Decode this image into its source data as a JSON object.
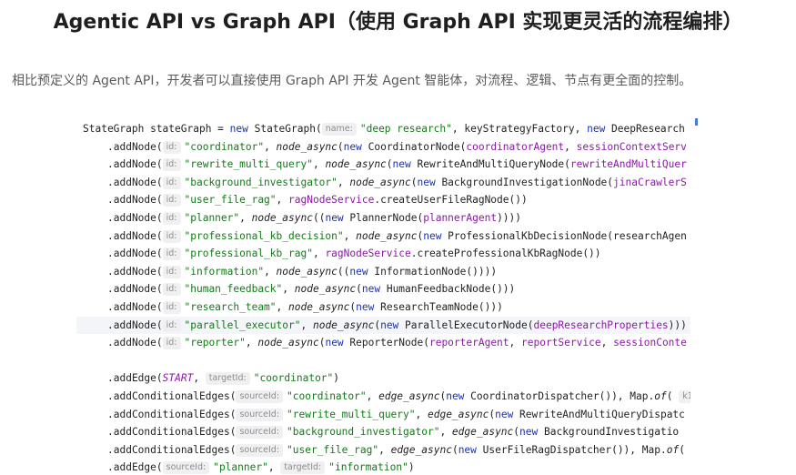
{
  "header": {
    "title": "Agentic API vs Graph API（使用 Graph API 实现更灵活的流程编排）",
    "subtitle": "相比预定义的 Agent API，开发者可以直接使用 Graph API 开发 Agent 智能体，对流程、逻辑、节点有更全面的控制。"
  },
  "code": {
    "lines": [
      {
        "indent": 0,
        "highlight": false,
        "tokens": [
          {
            "t": "StateGraph stateGraph = ",
            "c": "plain"
          },
          {
            "t": "new",
            "c": "kw"
          },
          {
            "t": " StateGraph(",
            "c": "plain"
          },
          {
            "t": "name:",
            "c": "hint"
          },
          {
            "t": "\"deep research\"",
            "c": "str"
          },
          {
            "t": ", keyStrategyFactory, ",
            "c": "plain"
          },
          {
            "t": "new",
            "c": "kw"
          },
          {
            "t": " DeepResearch",
            "c": "plain"
          }
        ]
      },
      {
        "indent": 4,
        "highlight": false,
        "tokens": [
          {
            "t": ".addNode(",
            "c": "plain"
          },
          {
            "t": "id:",
            "c": "hint"
          },
          {
            "t": "\"coordinator\"",
            "c": "str"
          },
          {
            "t": ", ",
            "c": "plain"
          },
          {
            "t": "node_async",
            "c": "fn"
          },
          {
            "t": "(",
            "c": "plain"
          },
          {
            "t": "new",
            "c": "kw"
          },
          {
            "t": " CoordinatorNode(",
            "c": "plain"
          },
          {
            "t": "coordinatorAgent",
            "c": "field"
          },
          {
            "t": ", ",
            "c": "plain"
          },
          {
            "t": "sessionContextServ",
            "c": "field"
          }
        ]
      },
      {
        "indent": 4,
        "highlight": false,
        "tokens": [
          {
            "t": ".addNode(",
            "c": "plain"
          },
          {
            "t": "id:",
            "c": "hint"
          },
          {
            "t": "\"rewrite_multi_query\"",
            "c": "str"
          },
          {
            "t": ", ",
            "c": "plain"
          },
          {
            "t": "node_async",
            "c": "fn"
          },
          {
            "t": "(",
            "c": "plain"
          },
          {
            "t": "new",
            "c": "kw"
          },
          {
            "t": " RewriteAndMultiQueryNode(",
            "c": "plain"
          },
          {
            "t": "rewriteAndMultiQuer",
            "c": "field"
          }
        ]
      },
      {
        "indent": 4,
        "highlight": false,
        "tokens": [
          {
            "t": ".addNode(",
            "c": "plain"
          },
          {
            "t": "id:",
            "c": "hint"
          },
          {
            "t": "\"background_investigator\"",
            "c": "str"
          },
          {
            "t": ", ",
            "c": "plain"
          },
          {
            "t": "node_async",
            "c": "fn"
          },
          {
            "t": "(",
            "c": "plain"
          },
          {
            "t": "new",
            "c": "kw"
          },
          {
            "t": " BackgroundInvestigationNode(",
            "c": "plain"
          },
          {
            "t": "jinaCrawlerS",
            "c": "field"
          }
        ]
      },
      {
        "indent": 4,
        "highlight": false,
        "tokens": [
          {
            "t": ".addNode(",
            "c": "plain"
          },
          {
            "t": "id:",
            "c": "hint"
          },
          {
            "t": "\"user_file_rag\"",
            "c": "str"
          },
          {
            "t": ", ",
            "c": "plain"
          },
          {
            "t": "ragNodeService",
            "c": "field"
          },
          {
            "t": ".createUserFileRagNode())",
            "c": "plain"
          }
        ]
      },
      {
        "indent": 4,
        "highlight": false,
        "tokens": [
          {
            "t": ".addNode(",
            "c": "plain"
          },
          {
            "t": "id:",
            "c": "hint"
          },
          {
            "t": "\"planner\"",
            "c": "str"
          },
          {
            "t": ", ",
            "c": "plain"
          },
          {
            "t": "node_async",
            "c": "fn"
          },
          {
            "t": "((",
            "c": "plain"
          },
          {
            "t": "new",
            "c": "kw"
          },
          {
            "t": " PlannerNode(",
            "c": "plain"
          },
          {
            "t": "plannerAgent",
            "c": "field"
          },
          {
            "t": "))))",
            "c": "plain"
          }
        ]
      },
      {
        "indent": 4,
        "highlight": false,
        "tokens": [
          {
            "t": ".addNode(",
            "c": "plain"
          },
          {
            "t": "id:",
            "c": "hint"
          },
          {
            "t": "\"professional_kb_decision\"",
            "c": "str"
          },
          {
            "t": ", ",
            "c": "plain"
          },
          {
            "t": "node_async",
            "c": "fn"
          },
          {
            "t": "(",
            "c": "plain"
          },
          {
            "t": "new",
            "c": "kw"
          },
          {
            "t": " ProfessionalKbDecisionNode(researchAgen",
            "c": "plain"
          }
        ]
      },
      {
        "indent": 4,
        "highlight": false,
        "tokens": [
          {
            "t": ".addNode(",
            "c": "plain"
          },
          {
            "t": "id:",
            "c": "hint"
          },
          {
            "t": "\"professional_kb_rag\"",
            "c": "str"
          },
          {
            "t": ", ",
            "c": "plain"
          },
          {
            "t": "ragNodeService",
            "c": "field"
          },
          {
            "t": ".createProfessionalKbRagNode())",
            "c": "plain"
          }
        ]
      },
      {
        "indent": 4,
        "highlight": false,
        "tokens": [
          {
            "t": ".addNode(",
            "c": "plain"
          },
          {
            "t": "id:",
            "c": "hint"
          },
          {
            "t": "\"information\"",
            "c": "str"
          },
          {
            "t": ", ",
            "c": "plain"
          },
          {
            "t": "node_async",
            "c": "fn"
          },
          {
            "t": "((",
            "c": "plain"
          },
          {
            "t": "new",
            "c": "kw"
          },
          {
            "t": " InformationNode())))",
            "c": "plain"
          }
        ]
      },
      {
        "indent": 4,
        "highlight": false,
        "tokens": [
          {
            "t": ".addNode(",
            "c": "plain"
          },
          {
            "t": "id:",
            "c": "hint"
          },
          {
            "t": "\"human_feedback\"",
            "c": "str"
          },
          {
            "t": ", ",
            "c": "plain"
          },
          {
            "t": "node_async",
            "c": "fn"
          },
          {
            "t": "(",
            "c": "plain"
          },
          {
            "t": "new",
            "c": "kw"
          },
          {
            "t": " HumanFeedbackNode()))",
            "c": "plain"
          }
        ]
      },
      {
        "indent": 4,
        "highlight": false,
        "tokens": [
          {
            "t": ".addNode(",
            "c": "plain"
          },
          {
            "t": "id:",
            "c": "hint"
          },
          {
            "t": "\"research_team\"",
            "c": "str"
          },
          {
            "t": ", ",
            "c": "plain"
          },
          {
            "t": "node_async",
            "c": "fn"
          },
          {
            "t": "(",
            "c": "plain"
          },
          {
            "t": "new",
            "c": "kw"
          },
          {
            "t": " ResearchTeamNode()))",
            "c": "plain"
          }
        ]
      },
      {
        "indent": 4,
        "highlight": true,
        "tokens": [
          {
            "t": ".addNode(",
            "c": "plain"
          },
          {
            "t": "id:",
            "c": "hint"
          },
          {
            "t": "\"parallel_executor\"",
            "c": "str"
          },
          {
            "t": ", ",
            "c": "plain"
          },
          {
            "t": "node_async",
            "c": "fn"
          },
          {
            "t": "(",
            "c": "plain"
          },
          {
            "t": "new",
            "c": "kw"
          },
          {
            "t": " ParallelExecutorNode(",
            "c": "plain"
          },
          {
            "t": "deepResearchProperties",
            "c": "field"
          },
          {
            "t": ")))",
            "c": "plain"
          }
        ]
      },
      {
        "indent": 4,
        "highlight": false,
        "tokens": [
          {
            "t": ".addNode(",
            "c": "plain"
          },
          {
            "t": "id:",
            "c": "hint"
          },
          {
            "t": "\"reporter\"",
            "c": "str"
          },
          {
            "t": ", ",
            "c": "plain"
          },
          {
            "t": "node_async",
            "c": "fn"
          },
          {
            "t": "(",
            "c": "plain"
          },
          {
            "t": "new",
            "c": "kw"
          },
          {
            "t": " ReporterNode(",
            "c": "plain"
          },
          {
            "t": "reporterAgent",
            "c": "field"
          },
          {
            "t": ", ",
            "c": "plain"
          },
          {
            "t": "reportService",
            "c": "field"
          },
          {
            "t": ", ",
            "c": "plain"
          },
          {
            "t": "sessionConte",
            "c": "field"
          }
        ]
      },
      {
        "indent": 0,
        "highlight": false,
        "tokens": []
      },
      {
        "indent": 4,
        "highlight": false,
        "tokens": [
          {
            "t": ".addEdge(",
            "c": "plain"
          },
          {
            "t": "START",
            "c": "const"
          },
          {
            "t": ",  ",
            "c": "plain"
          },
          {
            "t": "targetId:",
            "c": "hint"
          },
          {
            "t": "\"coordinator\"",
            "c": "str"
          },
          {
            "t": ")",
            "c": "plain"
          }
        ]
      },
      {
        "indent": 4,
        "highlight": false,
        "tokens": [
          {
            "t": ".addConditionalEdges(",
            "c": "plain"
          },
          {
            "t": "sourceId:",
            "c": "hint"
          },
          {
            "t": "\"coordinator\"",
            "c": "str"
          },
          {
            "t": ", ",
            "c": "plain"
          },
          {
            "t": "edge_async",
            "c": "fn"
          },
          {
            "t": "(",
            "c": "plain"
          },
          {
            "t": "new",
            "c": "kw"
          },
          {
            "t": " CoordinatorDispatcher()), Map.",
            "c": "plain"
          },
          {
            "t": "of",
            "c": "fn"
          },
          {
            "t": "( ",
            "c": "plain"
          },
          {
            "t": "k1",
            "c": "hint"
          }
        ]
      },
      {
        "indent": 4,
        "highlight": false,
        "tokens": [
          {
            "t": ".addConditionalEdges(",
            "c": "plain"
          },
          {
            "t": "sourceId:",
            "c": "hint"
          },
          {
            "t": "\"rewrite_multi_query\"",
            "c": "str"
          },
          {
            "t": ", ",
            "c": "plain"
          },
          {
            "t": "edge_async",
            "c": "fn"
          },
          {
            "t": "(",
            "c": "plain"
          },
          {
            "t": "new",
            "c": "kw"
          },
          {
            "t": " RewriteAndMultiQueryDispatc",
            "c": "plain"
          }
        ]
      },
      {
        "indent": 4,
        "highlight": false,
        "tokens": [
          {
            "t": ".addConditionalEdges(",
            "c": "plain"
          },
          {
            "t": "sourceId:",
            "c": "hint"
          },
          {
            "t": "\"background_investigator\"",
            "c": "str"
          },
          {
            "t": ", ",
            "c": "plain"
          },
          {
            "t": "edge_async",
            "c": "fn"
          },
          {
            "t": "(",
            "c": "plain"
          },
          {
            "t": "new",
            "c": "kw"
          },
          {
            "t": " BackgroundInvestigatio",
            "c": "plain"
          }
        ]
      },
      {
        "indent": 4,
        "highlight": false,
        "tokens": [
          {
            "t": ".addConditionalEdges(",
            "c": "plain"
          },
          {
            "t": "sourceId:",
            "c": "hint"
          },
          {
            "t": "\"user_file_rag\"",
            "c": "str"
          },
          {
            "t": ", ",
            "c": "plain"
          },
          {
            "t": "edge_async",
            "c": "fn"
          },
          {
            "t": "(",
            "c": "plain"
          },
          {
            "t": "new",
            "c": "kw"
          },
          {
            "t": " UserFileRagDispatcher()), Map.",
            "c": "plain"
          },
          {
            "t": "of",
            "c": "fn"
          },
          {
            "t": "(",
            "c": "plain"
          }
        ]
      },
      {
        "indent": 4,
        "highlight": false,
        "tokens": [
          {
            "t": ".addEdge(",
            "c": "plain"
          },
          {
            "t": "sourceId:",
            "c": "hint"
          },
          {
            "t": "\"planner\"",
            "c": "str"
          },
          {
            "t": ",  ",
            "c": "plain"
          },
          {
            "t": "targetId:",
            "c": "hint"
          },
          {
            "t": "\"information\"",
            "c": "str"
          },
          {
            "t": ")",
            "c": "plain"
          }
        ]
      }
    ]
  }
}
